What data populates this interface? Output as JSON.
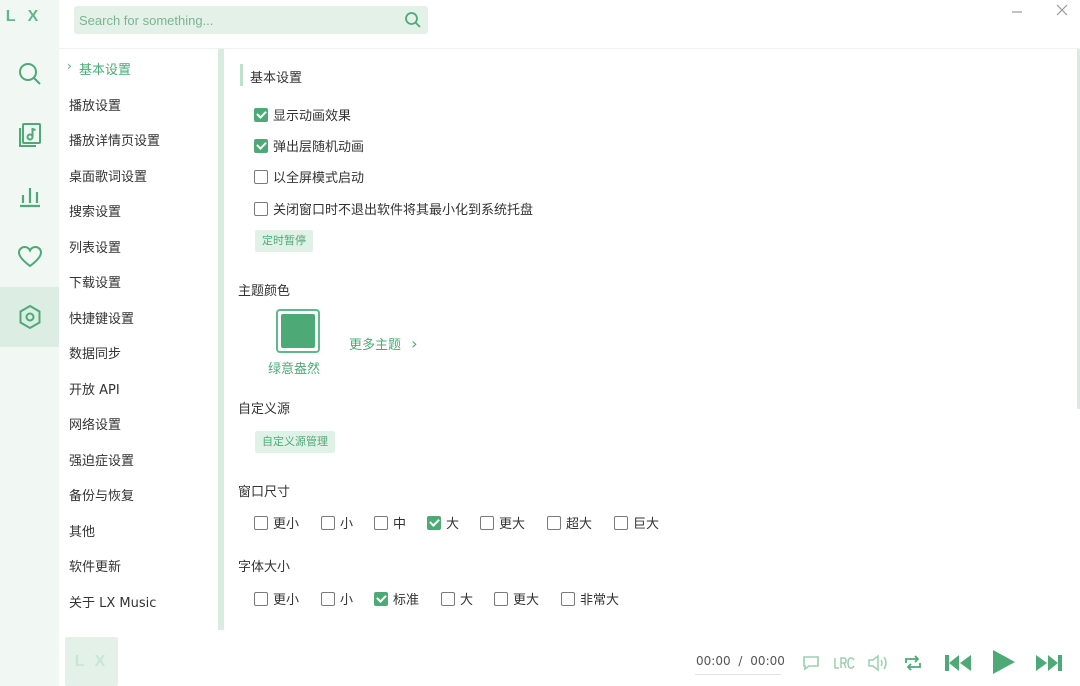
{
  "app": {
    "logo": "L X",
    "cover_logo": "L X"
  },
  "search": {
    "placeholder": "Search for something..."
  },
  "rail": [
    "search-icon",
    "music-list-icon",
    "leaderboard-icon",
    "heart-icon",
    "settings-icon"
  ],
  "nav": {
    "items": [
      "基本设置",
      "播放设置",
      "播放详情页设置",
      "桌面歌词设置",
      "搜索设置",
      "列表设置",
      "下载设置",
      "快捷键设置",
      "数据同步",
      "开放 API",
      "网络设置",
      "强迫症设置",
      "备份与恢复",
      "其他",
      "软件更新",
      "关于 LX Music"
    ],
    "active_index": 0
  },
  "basic": {
    "title": "基本设置",
    "options": [
      {
        "label": "显示动画效果",
        "checked": true
      },
      {
        "label": "弹出层随机动画",
        "checked": true
      },
      {
        "label": "以全屏模式启动",
        "checked": false
      },
      {
        "label": "关闭窗口时不退出软件将其最小化到系统托盘",
        "checked": false
      }
    ],
    "timer_button": "定时暂停"
  },
  "theme": {
    "title": "主题颜色",
    "current_name": "绿意盎然",
    "current_color": "#4daa76",
    "more_label": "更多主题"
  },
  "source": {
    "title": "自定义源",
    "manage_button": "自定义源管理"
  },
  "window_size": {
    "title": "窗口尺寸",
    "options": [
      {
        "label": "更小",
        "checked": false
      },
      {
        "label": "小",
        "checked": false
      },
      {
        "label": "中",
        "checked": false
      },
      {
        "label": "大",
        "checked": true
      },
      {
        "label": "更大",
        "checked": false
      },
      {
        "label": "超大",
        "checked": false
      },
      {
        "label": "巨大",
        "checked": false
      }
    ]
  },
  "font_size": {
    "title": "字体大小",
    "options": [
      {
        "label": "更小",
        "checked": false
      },
      {
        "label": "小",
        "checked": false
      },
      {
        "label": "标准",
        "checked": true
      },
      {
        "label": "大",
        "checked": false
      },
      {
        "label": "更大",
        "checked": false
      },
      {
        "label": "非常大",
        "checked": false
      }
    ]
  },
  "player": {
    "time_current": "00:00",
    "time_separator": "/",
    "time_total": "00:00"
  },
  "colors": {
    "accent": "#4daa76",
    "rail_bg": "#f1f8f3",
    "pill_bg": "#e0f2e7"
  }
}
